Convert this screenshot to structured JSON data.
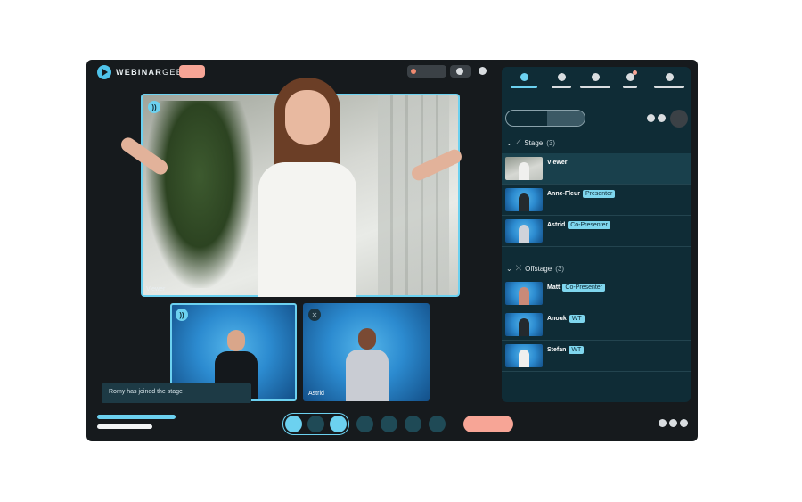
{
  "brand": {
    "name_bold": "WEBINAR",
    "name_light": "GEEK"
  },
  "stage": {
    "main_camera_label": "Viewer",
    "tiles": [
      {
        "name": "",
        "speaking": true
      },
      {
        "name": "Astrid",
        "muted": true
      }
    ],
    "toast": "Romy has joined the stage"
  },
  "panel": {
    "tabs": [
      {
        "active": true
      },
      {
        "active": false
      },
      {
        "active": false
      },
      {
        "active": false,
        "notification": true
      },
      {
        "active": false
      }
    ],
    "sections": [
      {
        "title": "Stage",
        "count": "(3)",
        "rows": [
          {
            "name": "Viewer",
            "role": ""
          },
          {
            "name": "Anne-Fleur",
            "role": "Presenter"
          },
          {
            "name": "Astrid",
            "role": "Co-Presenter"
          }
        ]
      },
      {
        "title": "Offstage",
        "count": "(3)",
        "rows": [
          {
            "name": "Matt",
            "role": "Co-Presenter"
          },
          {
            "name": "Anouk",
            "role": "WT"
          },
          {
            "name": "Stefan",
            "role": "WT"
          }
        ]
      }
    ]
  },
  "colors": {
    "accent": "#6cd1f0",
    "coral": "#f7a596",
    "panel_bg": "#0f2c36",
    "app_bg": "#161a1d"
  }
}
